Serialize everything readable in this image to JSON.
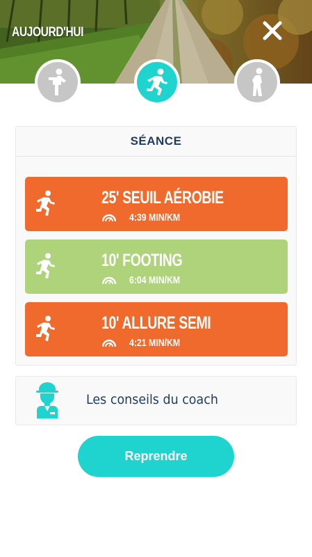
{
  "header": {
    "title": "AUJOURD'HUI",
    "close_icon": "close-icon"
  },
  "steps": [
    {
      "icon": "warmup-icon",
      "state": "inactive"
    },
    {
      "icon": "running-icon",
      "state": "active"
    },
    {
      "icon": "stretching-icon",
      "state": "inactive"
    }
  ],
  "session": {
    "title": "SÉANCE",
    "blocks": [
      {
        "name": "25' SEUIL AÉROBIE",
        "pace": "4:39 MIN/KM",
        "color": "#f0692d",
        "icon": "runner-icon"
      },
      {
        "name": "10' FOOTING",
        "pace": "6:04 MIN/KM",
        "color": "#aed37a",
        "icon": "runner-icon"
      },
      {
        "name": "10' ALLURE SEMI",
        "pace": "4:21 MIN/KM",
        "color": "#f0692d",
        "icon": "runner-icon"
      }
    ]
  },
  "coach": {
    "label": "Les conseils du coach",
    "icon": "coach-icon"
  },
  "resume_button": {
    "label": "Reprendre"
  },
  "colors": {
    "accent": "#1fd3cf",
    "orange": "#f0692d",
    "green": "#aed37a",
    "navy": "#1d3c5f",
    "inactive": "#c6c6c6"
  }
}
